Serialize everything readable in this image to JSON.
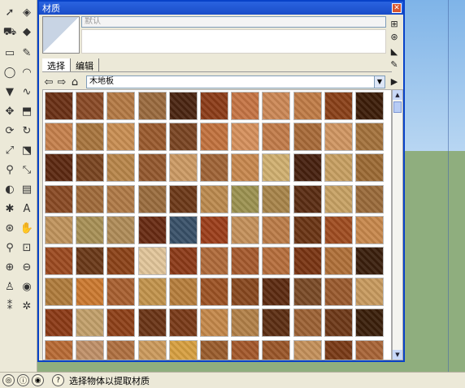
{
  "window": {
    "title": "材质",
    "close_label": "✕"
  },
  "editor": {
    "name_placeholder": "默认"
  },
  "tabs": [
    {
      "label": "选择"
    },
    {
      "label": "编辑"
    }
  ],
  "library": {
    "selected": "木地板"
  },
  "status": {
    "text": "选择物体以提取材质"
  },
  "swatch_colors": [
    [
      "#6a3015",
      "#8a4a26",
      "#b47a44",
      "#9a6a3e",
      "#4a2410",
      "#8c3c18",
      "#c67444",
      "#cc8856",
      "#c07c46",
      "#8a4018",
      "#3c1c08"
    ],
    [
      "#c6804c",
      "#a8753e",
      "#c98e52",
      "#9a5a2e",
      "#7a4422",
      "#c2723e",
      "#d6905c",
      "#c27c4a",
      "#a86a38",
      "#d09662",
      "#a4723c"
    ],
    [
      "#5c2810",
      "#7a4420",
      "#b8864a",
      "#94582e",
      "#cc9a64",
      "#a06436",
      "#c8884e",
      "#d0b070",
      "#46200e",
      "#c8a062",
      "#9c6a34"
    ],
    [
      "#8a4a24",
      "#a06a3a",
      "#b07a46",
      "#9a6c3e",
      "#6c3818",
      "#bc8a4e",
      "#9c9250",
      "#a8844a",
      "#5a2c12",
      "#c8a264",
      "#9a6a3a"
    ],
    [
      "#c0945c",
      "#a89056",
      "#b08c58",
      "#682a12",
      "#385068",
      "#9c3e1a",
      "#c4905a",
      "#bc7c48",
      "#6a3414",
      "#a04c20",
      "#c8884c"
    ],
    [
      "#9c4a20",
      "#6a3818",
      "#8c4218",
      "#e2c69a",
      "#8c3a18",
      "#b06a3a",
      "#a65a2e",
      "#b66e3c",
      "#7a3412",
      "#b07038",
      "#3a1e0c"
    ],
    [
      "#b07c3c",
      "#cc7a30",
      "#a86030",
      "#c2944c",
      "#b67e3c",
      "#9c5224",
      "#88481e",
      "#5c2a10",
      "#7a4a26",
      "#9a5a2e",
      "#c89a5e"
    ],
    [
      "#8c3a16",
      "#c2a06a",
      "#8e4018",
      "#6a3416",
      "#7a3a18",
      "#c4884a",
      "#b28048",
      "#5c2e12",
      "#9c6234",
      "#6e3818",
      "#3a1e0a"
    ],
    [
      "#b86a34",
      "#c09068",
      "#b07040",
      "#cc9a5c",
      "#d8a040",
      "#9a5c2c",
      "#a4582a",
      "#9a5628",
      "#c4905a",
      "#7a3a16",
      "#a86436"
    ]
  ],
  "icons": {
    "toolbar": [
      "select-arrow-icon",
      "eraser-icon",
      "paint-bucket-icon",
      "tape-eraser-icon",
      "rectangle-icon",
      "pencil-icon",
      "circle-icon",
      "arc-icon",
      "polygon-icon",
      "freehand-icon",
      "move-icon",
      "push-pull-icon",
      "rotate-icon",
      "follow-me-icon",
      "scale-icon",
      "offset-icon",
      "tape-measure-icon",
      "dimension-icon",
      "protractor-icon",
      "text-icon",
      "axes-icon",
      "3d-text-icon",
      "orbit-icon",
      "pan-icon",
      "zoom-icon",
      "zoom-window-icon",
      "zoom-extents-icon",
      "previous-view-icon",
      "walk-icon",
      "look-around-icon",
      "footprint-icon",
      "section-plane-icon"
    ]
  }
}
